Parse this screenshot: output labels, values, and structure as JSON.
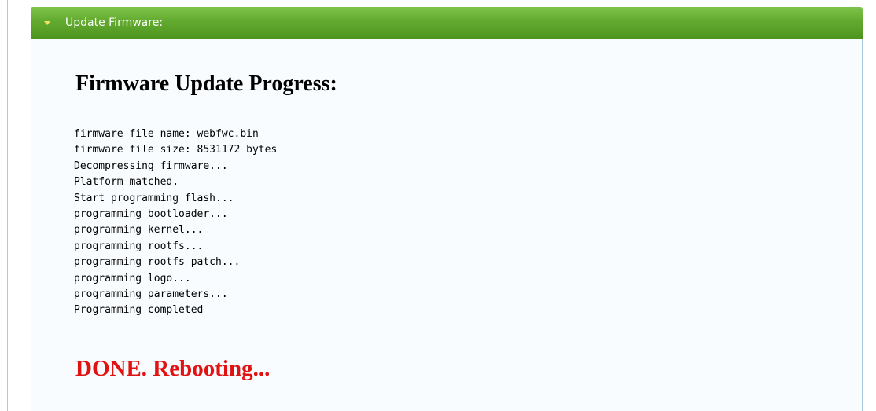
{
  "panel": {
    "header_title": "Update Firmware:",
    "header_icon": "triangle-down-icon",
    "accent_color": "#62aa2f"
  },
  "main": {
    "heading": "Firmware Update Progress:",
    "log_lines": [
      "firmware file name: webfwc.bin",
      "firmware file size: 8531172 bytes",
      "Decompressing firmware...",
      "Platform matched.",
      "Start programming flash...",
      "programming bootloader...",
      "programming kernel...",
      "programming rootfs...",
      "programming rootfs patch...",
      "programming logo...",
      "programming parameters...",
      "Programming completed"
    ],
    "status": "DONE. Rebooting...",
    "status_color": "#e01212"
  }
}
